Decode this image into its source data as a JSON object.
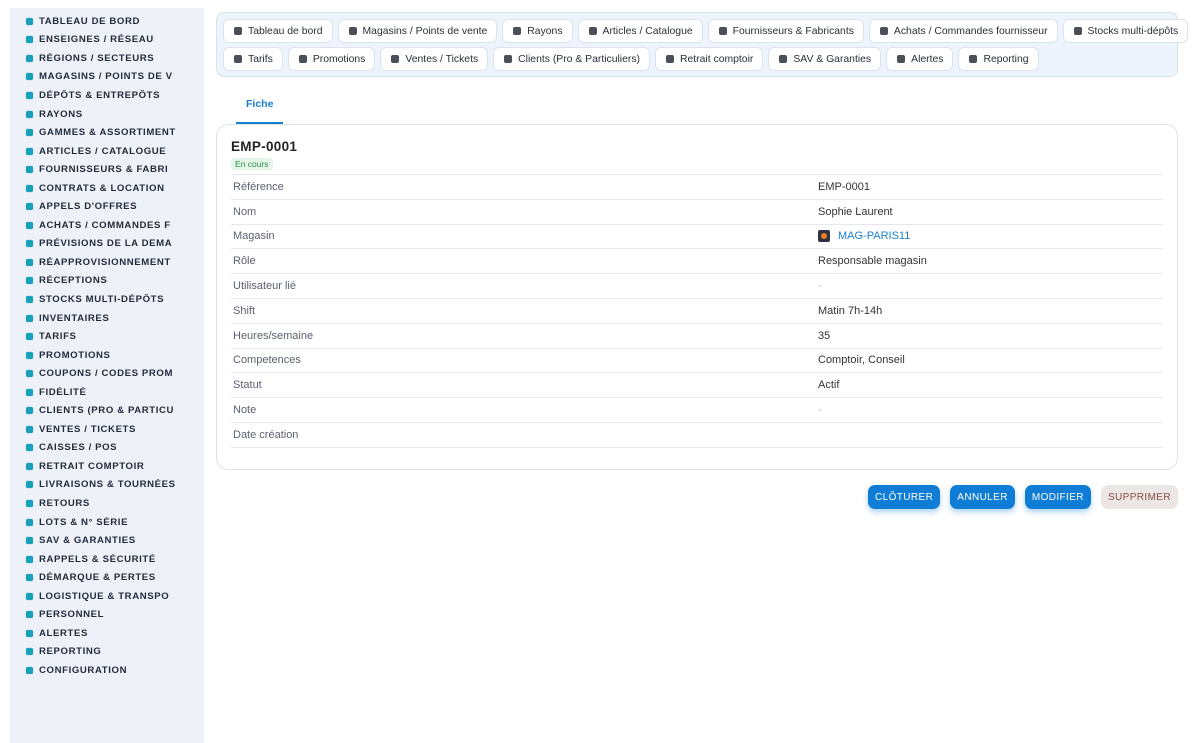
{
  "sidebar": {
    "items": [
      {
        "label": "TABLEAU DE BORD",
        "icon": "dashboard-icon"
      },
      {
        "label": "ENSEIGNES / RÉSEAU",
        "icon": "flag-icon"
      },
      {
        "label": "RÉGIONS / SECTEURS",
        "icon": "map-icon"
      },
      {
        "label": "MAGASINS / POINTS DE V",
        "icon": "store-icon"
      },
      {
        "label": "DÉPÔTS & ENTREPÔTS",
        "icon": "warehouse-icon"
      },
      {
        "label": "RAYONS",
        "icon": "shelf-icon"
      },
      {
        "label": "GAMMES & ASSORTIMENT",
        "icon": "layers-icon"
      },
      {
        "label": "ARTICLES / CATALOGUE",
        "icon": "catalog-icon"
      },
      {
        "label": "FOURNISSEURS & FABRI",
        "icon": "truck-icon"
      },
      {
        "label": "CONTRATS & LOCATION",
        "icon": "contract-icon"
      },
      {
        "label": "APPELS D'OFFRES",
        "icon": "gavel-icon"
      },
      {
        "label": "ACHATS / COMMANDES F",
        "icon": "cart-icon"
      },
      {
        "label": "PRÉVISIONS DE LA DEMA",
        "icon": "chart-icon"
      },
      {
        "label": "RÉAPPROVISIONNEMENT",
        "icon": "refresh-icon"
      },
      {
        "label": "RÉCEPTIONS",
        "icon": "dolly-icon"
      },
      {
        "label": "STOCKS MULTI-DÉPÔTS",
        "icon": "boxes-icon"
      },
      {
        "label": "INVENTAIRES",
        "icon": "clipboard-icon"
      },
      {
        "label": "TARIFS",
        "icon": "tag-icon"
      },
      {
        "label": "PROMOTIONS",
        "icon": "percent-icon"
      },
      {
        "label": "COUPONS / CODES PROM",
        "icon": "ticket-icon"
      },
      {
        "label": "FIDÉLITÉ",
        "icon": "card-icon"
      },
      {
        "label": "CLIENTS (PRO & PARTICU",
        "icon": "user-icon"
      },
      {
        "label": "VENTES / TICKETS",
        "icon": "receipt-icon"
      },
      {
        "label": "CAISSES / POS",
        "icon": "register-icon"
      },
      {
        "label": "RETRAIT COMPTOIR",
        "icon": "car-icon"
      },
      {
        "label": "LIVRAISONS & TOURNÉES",
        "icon": "delivery-icon"
      },
      {
        "label": "RETOURS",
        "icon": "undo-icon"
      },
      {
        "label": "LOTS & N° SÉRIE",
        "icon": "barcode-icon"
      },
      {
        "label": "SAV & GARANTIES",
        "icon": "tools-icon"
      },
      {
        "label": "RAPPELS & SÉCURITÉ",
        "icon": "warning-icon"
      },
      {
        "label": "DÉMARQUE & PERTES",
        "icon": "trash-icon"
      },
      {
        "label": "LOGISTIQUE & TRANSPO",
        "icon": "route-icon"
      },
      {
        "label": "PERSONNEL",
        "icon": "users-icon"
      },
      {
        "label": "ALERTES",
        "icon": "bell-icon"
      },
      {
        "label": "REPORTING",
        "icon": "pie-icon"
      },
      {
        "label": "CONFIGURATION",
        "icon": "gear-icon"
      }
    ]
  },
  "topnav": {
    "row1": [
      {
        "label": "Tableau de bord",
        "icon": "dashboard-icon"
      },
      {
        "label": "Magasins / Points de vente",
        "icon": "store-icon"
      },
      {
        "label": "Rayons",
        "icon": "shelf-icon"
      },
      {
        "label": "Articles / Catalogue",
        "icon": "catalog-icon"
      },
      {
        "label": "Fournisseurs & Fabricants",
        "icon": "truck-icon"
      },
      {
        "label": "Achats / Commandes fournisseur",
        "icon": "cart-icon"
      },
      {
        "label": "Stocks multi-dépôts",
        "icon": "boxes-icon"
      }
    ],
    "row2": [
      {
        "label": "Tarifs",
        "icon": "tag-icon"
      },
      {
        "label": "Promotions",
        "icon": "percent-icon"
      },
      {
        "label": "Ventes / Tickets",
        "icon": "receipt-icon"
      },
      {
        "label": "Clients (Pro & Particuliers)",
        "icon": "user-icon"
      },
      {
        "label": "Retrait comptoir",
        "icon": "car-icon"
      },
      {
        "label": "SAV & Garanties",
        "icon": "tools-icon"
      },
      {
        "label": "Alertes",
        "icon": "bell-icon"
      },
      {
        "label": "Reporting",
        "icon": "pie-icon"
      }
    ]
  },
  "tabs": {
    "fiche": "Fiche"
  },
  "record": {
    "title": "EMP-0001",
    "status_badge": "En cours",
    "fields": [
      {
        "key": "Référence",
        "value": "EMP-0001",
        "kind": "text"
      },
      {
        "key": "Nom",
        "value": "Sophie Laurent",
        "kind": "text"
      },
      {
        "key": "Magasin",
        "value": "MAG-PARIS11",
        "kind": "link"
      },
      {
        "key": "Rôle",
        "value": "Responsable magasin",
        "kind": "text"
      },
      {
        "key": "Utilisateur lié",
        "value": "-",
        "kind": "muted"
      },
      {
        "key": "Shift",
        "value": "Matin 7h-14h",
        "kind": "text"
      },
      {
        "key": "Heures/semaine",
        "value": "35",
        "kind": "text"
      },
      {
        "key": "Competences",
        "value": "Comptoir, Conseil",
        "kind": "text"
      },
      {
        "key": "Statut",
        "value": "Actif",
        "kind": "text"
      },
      {
        "key": "Note",
        "value": "-",
        "kind": "muted"
      },
      {
        "key": "Date création",
        "value": "",
        "kind": "text"
      }
    ]
  },
  "actions": {
    "close": "CLÔTURER",
    "cancel": "ANNULER",
    "edit": "MODIFIER",
    "delete": "SUPPRIMER"
  },
  "colors": {
    "accent": "#0f7dd6",
    "sidebar_icon": "#1aa0b8",
    "badge_bg": "#e4f6e8",
    "badge_text": "#2f8f4a"
  }
}
